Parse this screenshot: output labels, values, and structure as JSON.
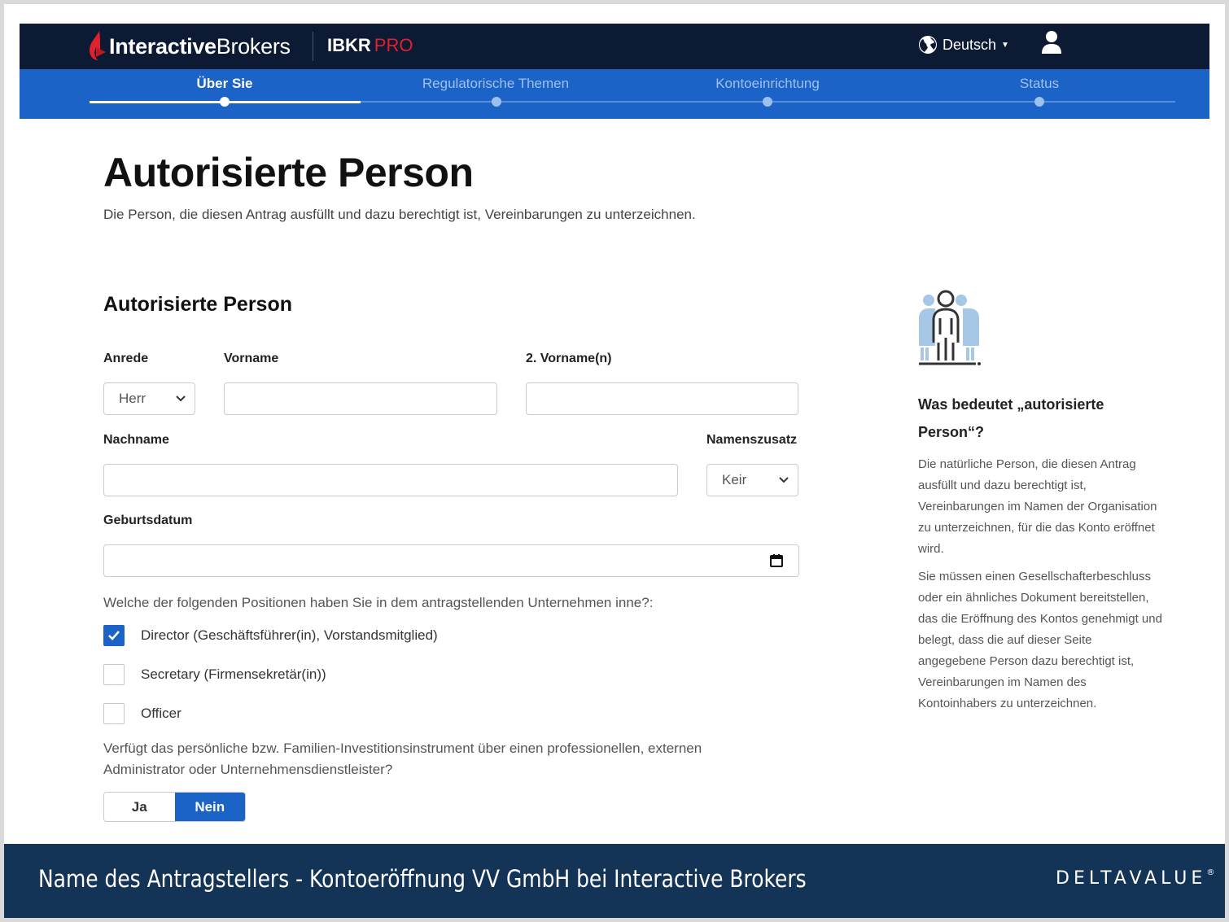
{
  "header": {
    "logo_text_bold": "Interactive",
    "logo_text_light": "Brokers",
    "product_main": "IBKR",
    "product_accent": "PRO",
    "language_label": "Deutsch",
    "brand_color": "#0c1a33",
    "accent_color": "#e0222c"
  },
  "steps": [
    {
      "label": "Über Sie",
      "active": true
    },
    {
      "label": "Regulatorische Themen",
      "active": false
    },
    {
      "label": "Kontoeinrichtung",
      "active": false
    },
    {
      "label": "Status",
      "active": false
    }
  ],
  "page": {
    "title": "Autorisierte Person",
    "subtitle": "Die Person, die diesen Antrag ausfüllt und dazu berechtigt ist, Vereinbarungen zu unterzeichnen."
  },
  "form": {
    "section_title": "Autorisierte Person",
    "salutation": {
      "label": "Anrede",
      "value": "Herr"
    },
    "first_name": {
      "label": "Vorname",
      "value": ""
    },
    "middle_name": {
      "label": "2. Vorname(n)",
      "value": ""
    },
    "last_name": {
      "label": "Nachname",
      "value": ""
    },
    "suffix": {
      "label": "Namenszusatz",
      "value": "Keir"
    },
    "birthdate": {
      "label": "Geburtsdatum",
      "value": ""
    },
    "positions_question": "Welche der folgenden Positionen haben Sie in dem antragstellenden Unternehmen inne?:",
    "positions": [
      {
        "label": "Director (Geschäftsführer(in), Vorstandsmitglied)",
        "checked": true
      },
      {
        "label": "Secretary (Firmensekretär(in))",
        "checked": false
      },
      {
        "label": "Officer",
        "checked": false
      }
    ],
    "admin_question": "Verfügt das persönliche bzw. Familien-Investitionsinstrument über einen professionellen, externen Administrator oder Unternehmensdienstleister?",
    "toggle_yes": "Ja",
    "toggle_no": "Nein",
    "toggle_selected": "Nein",
    "primary_color": "#1b63c6"
  },
  "sidebar": {
    "icon": "authorized-person-icon",
    "title": "Was bedeutet „autorisierte Person“?",
    "paragraph1": "Die natürliche Person, die diesen Antrag ausfüllt und dazu berechtigt ist, Vereinbarungen im Namen der Organisation zu unterzeichnen, für die das Konto eröffnet wird.",
    "paragraph2": "Sie müssen einen Gesellschafterbeschluss oder ein ähnliches Dokument bereitstellen, das die Eröffnung des Kontos genehmigt und belegt, dass die auf dieser Seite angegebene Person dazu berechtigt ist, Vereinbarungen im Namen des Kontoinhabers zu unterzeichnen."
  },
  "banner": {
    "title": "Name des Antragstellers - Kontoeröffnung VV GmbH bei Interactive Brokers",
    "brand": "DELTAVALUE",
    "brand_mark": "®",
    "color": "#143457"
  }
}
